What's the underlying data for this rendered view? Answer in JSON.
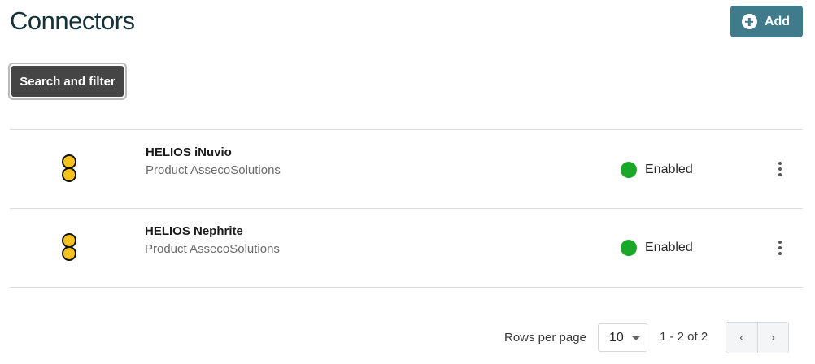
{
  "header": {
    "title": "Connectors",
    "add_label": "Add"
  },
  "toolbar": {
    "search_filter_label": "Search and filter"
  },
  "connectors": [
    {
      "name": "HELIOS iNuvio",
      "product": "Product AssecoSolutions",
      "status": "Enabled",
      "logo_icon": "helios-logo-icon",
      "status_color": "#1da72a"
    },
    {
      "name": "HELIOS Nephrite",
      "product": "Product AssecoSolutions",
      "status": "Enabled",
      "logo_icon": "helios-logo-icon",
      "status_color": "#1da72a"
    }
  ],
  "pagination": {
    "rows_per_page_label": "Rows per page",
    "rows_per_page_value": "10",
    "range": "1 - 2 of 2",
    "prev_symbol": "‹",
    "next_symbol": "›"
  },
  "colors": {
    "accent": "#3f7b8b",
    "dark_button": "#454545",
    "logo_yellow": "#f7c21e"
  }
}
